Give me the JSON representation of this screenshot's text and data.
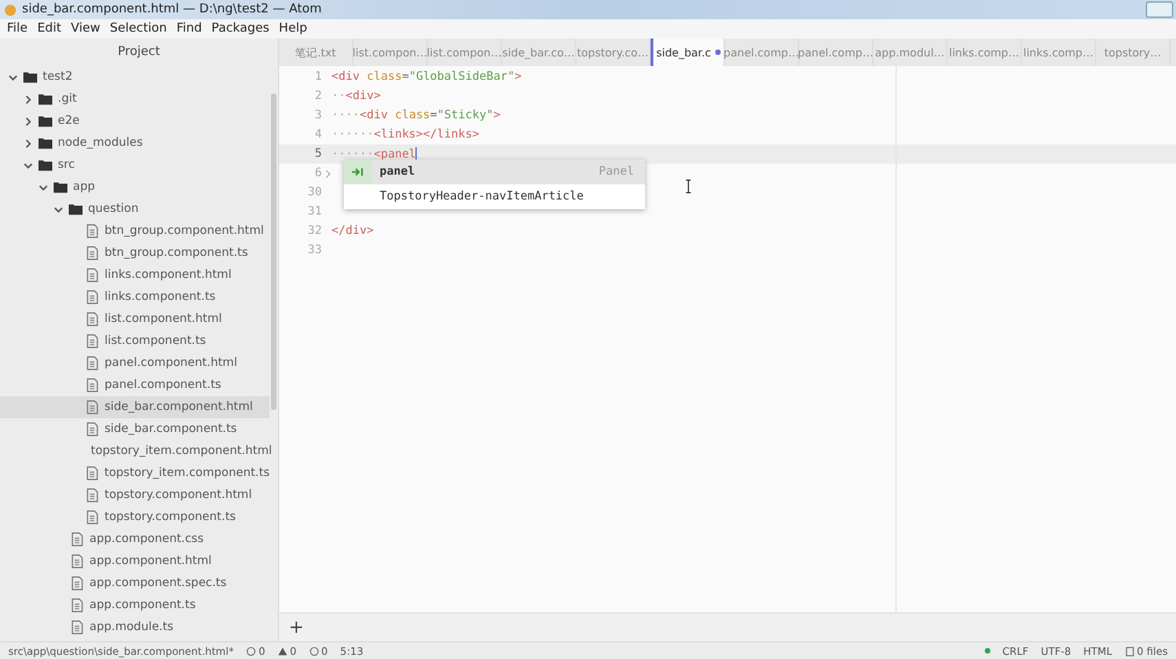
{
  "window": {
    "title": "side_bar.component.html — D:\\ng\\test2 — Atom"
  },
  "menu": [
    "File",
    "Edit",
    "View",
    "Selection",
    "Find",
    "Packages",
    "Help"
  ],
  "sidebar": {
    "title": "Project",
    "tree": [
      {
        "name": "test2",
        "kind": "folder",
        "expanded": true,
        "selected": false,
        "children": [
          {
            "name": ".git",
            "kind": "folder",
            "expanded": false,
            "selected": false
          },
          {
            "name": "e2e",
            "kind": "folder",
            "expanded": false,
            "selected": false
          },
          {
            "name": "node_modules",
            "kind": "folder",
            "expanded": false,
            "selected": false
          },
          {
            "name": "src",
            "kind": "folder",
            "expanded": true,
            "selected": false,
            "children": [
              {
                "name": "app",
                "kind": "folder",
                "expanded": true,
                "selected": false,
                "children": [
                  {
                    "name": "question",
                    "kind": "folder",
                    "expanded": true,
                    "selected": false,
                    "children": [
                      {
                        "name": "btn_group.component.html",
                        "kind": "file",
                        "selected": false
                      },
                      {
                        "name": "btn_group.component.ts",
                        "kind": "file",
                        "selected": false
                      },
                      {
                        "name": "links.component.html",
                        "kind": "file",
                        "selected": false
                      },
                      {
                        "name": "links.component.ts",
                        "kind": "file",
                        "selected": false
                      },
                      {
                        "name": "list.component.html",
                        "kind": "file",
                        "selected": false
                      },
                      {
                        "name": "list.component.ts",
                        "kind": "file",
                        "selected": false
                      },
                      {
                        "name": "panel.component.html",
                        "kind": "file",
                        "selected": false
                      },
                      {
                        "name": "panel.component.ts",
                        "kind": "file",
                        "selected": false
                      },
                      {
                        "name": "side_bar.component.html",
                        "kind": "file",
                        "selected": true
                      },
                      {
                        "name": "side_bar.component.ts",
                        "kind": "file",
                        "selected": false
                      },
                      {
                        "name": "topstory_item.component.html",
                        "kind": "file",
                        "selected": false
                      },
                      {
                        "name": "topstory_item.component.ts",
                        "kind": "file",
                        "selected": false
                      },
                      {
                        "name": "topstory.component.html",
                        "kind": "file",
                        "selected": false
                      },
                      {
                        "name": "topstory.component.ts",
                        "kind": "file",
                        "selected": false
                      }
                    ]
                  },
                  {
                    "name": "app.component.css",
                    "kind": "file",
                    "selected": false
                  },
                  {
                    "name": "app.component.html",
                    "kind": "file",
                    "selected": false
                  },
                  {
                    "name": "app.component.spec.ts",
                    "kind": "file",
                    "selected": false
                  },
                  {
                    "name": "app.component.ts",
                    "kind": "file",
                    "selected": false
                  },
                  {
                    "name": "app.module.ts",
                    "kind": "file",
                    "selected": false
                  }
                ]
              }
            ]
          }
        ]
      }
    ]
  },
  "tabs": [
    {
      "label": "笔记.txt",
      "selected": false,
      "modified": false
    },
    {
      "label": "list.compon…",
      "selected": false,
      "modified": false
    },
    {
      "label": "list.compon…",
      "selected": false,
      "modified": false
    },
    {
      "label": "side_bar.co…",
      "selected": false,
      "modified": false
    },
    {
      "label": "topstory.co…",
      "selected": false,
      "modified": false
    },
    {
      "label": "side_bar.c",
      "selected": true,
      "modified": true
    },
    {
      "label": "panel.comp…",
      "selected": false,
      "modified": false
    },
    {
      "label": "panel.comp…",
      "selected": false,
      "modified": false
    },
    {
      "label": "app.modul…",
      "selected": false,
      "modified": false
    },
    {
      "label": "links.comp…",
      "selected": false,
      "modified": false
    },
    {
      "label": "links.comp…",
      "selected": false,
      "modified": false
    },
    {
      "label": "topstory…",
      "selected": false,
      "modified": false
    }
  ],
  "editor": {
    "lines": [
      {
        "number": "1",
        "current": false,
        "folded": false,
        "tokens": [
          {
            "kind": "tag",
            "text": "<div"
          },
          {
            "kind": "attr",
            "text": " class"
          },
          {
            "kind": "plain",
            "text": "="
          },
          {
            "kind": "string",
            "text": "\"GlobalSideBar\""
          },
          {
            "kind": "tag",
            "text": ">"
          }
        ]
      },
      {
        "number": "2",
        "current": false,
        "folded": false,
        "tokens": [
          {
            "kind": "invisible",
            "text": "··"
          },
          {
            "kind": "tag",
            "text": "<div>"
          }
        ]
      },
      {
        "number": "3",
        "current": false,
        "folded": false,
        "tokens": [
          {
            "kind": "invisible",
            "text": "····"
          },
          {
            "kind": "tag",
            "text": "<div"
          },
          {
            "kind": "attr",
            "text": " class"
          },
          {
            "kind": "plain",
            "text": "="
          },
          {
            "kind": "string",
            "text": "\"Sticky\""
          },
          {
            "kind": "tag",
            "text": ">"
          }
        ]
      },
      {
        "number": "4",
        "current": false,
        "folded": false,
        "tokens": [
          {
            "kind": "invisible",
            "text": "······"
          },
          {
            "kind": "tag",
            "text": "<links></links>"
          }
        ]
      },
      {
        "number": "5",
        "current": true,
        "folded": false,
        "tokens": [
          {
            "kind": "invisible",
            "text": "······"
          },
          {
            "kind": "tag",
            "text": "<panel"
          }
        ]
      },
      {
        "number": "6",
        "current": false,
        "folded": true
      },
      {
        "number": "30",
        "current": false,
        "folded": false
      },
      {
        "number": "31",
        "current": false,
        "folded": false
      },
      {
        "number": "32",
        "current": false,
        "folded": false,
        "tokens": [
          {
            "kind": "tag",
            "text": "</div>"
          }
        ]
      },
      {
        "number": "33",
        "current": false,
        "folded": false
      }
    ],
    "autocomplete": [
      {
        "text": "panel",
        "type": "Panel",
        "selected": true,
        "snippet": true
      },
      {
        "text": "TopstoryHeader-navItemArticle",
        "selected": false,
        "snippet": false
      }
    ],
    "add_button": "+"
  },
  "status_bar": {
    "path": "src\\app\\question\\side_bar.component.html*",
    "errors": "0",
    "warnings": "0",
    "infos": "0",
    "cursor": "5:13",
    "line_ending": "CRLF",
    "encoding": "UTF-8",
    "grammar": "HTML",
    "files": "0 files"
  }
}
